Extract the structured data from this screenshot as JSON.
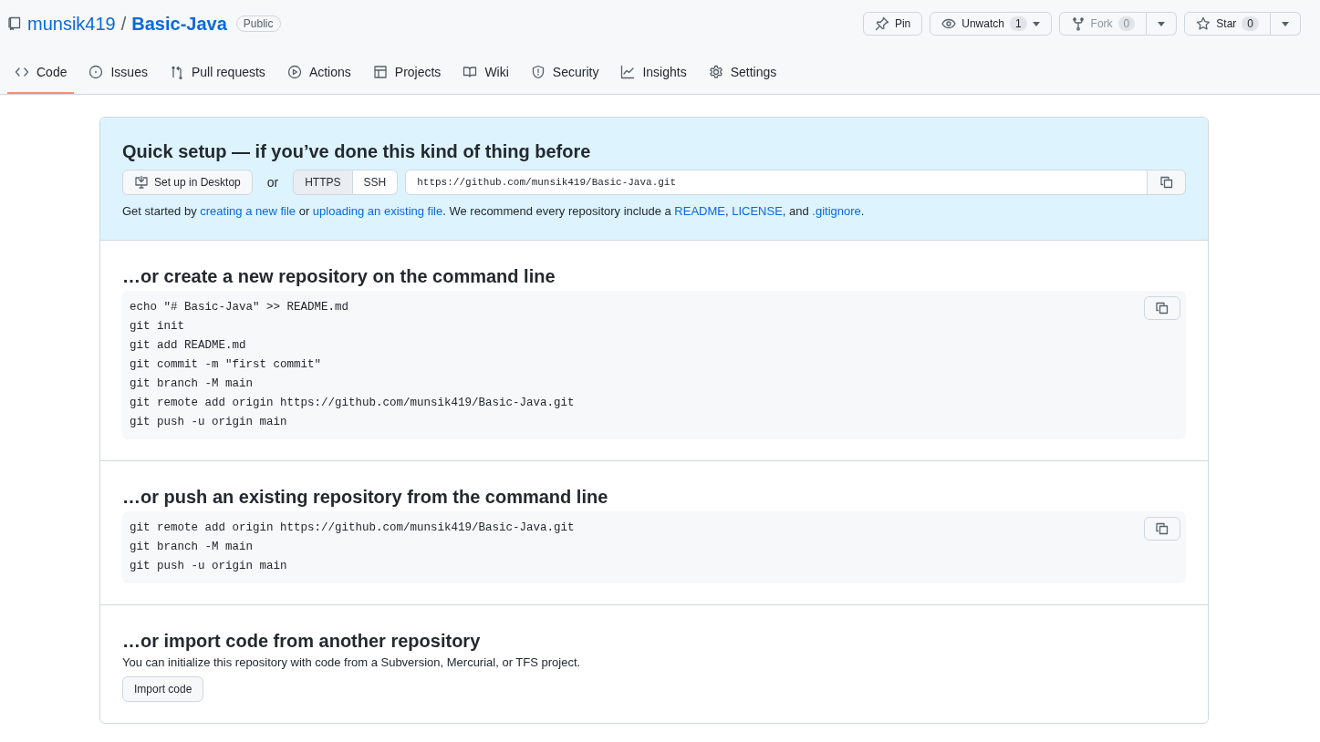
{
  "repo": {
    "owner": "munsik419",
    "separator": "/",
    "name": "Basic-Java",
    "visibility": "Public"
  },
  "actions": [
    {
      "kind": "pin",
      "label": "Pin",
      "disabled": false
    },
    {
      "kind": "watch",
      "label": "Unwatch",
      "count": "1",
      "disabled": false
    },
    {
      "kind": "fork",
      "label": "Fork",
      "count": "0",
      "disabled": true
    },
    {
      "kind": "star",
      "label": "Star",
      "count": "0",
      "disabled": false
    }
  ],
  "tabs": [
    {
      "kind": "code",
      "label": "Code",
      "selected": true
    },
    {
      "kind": "issues",
      "label": "Issues",
      "selected": false
    },
    {
      "kind": "pr",
      "label": "Pull requests",
      "selected": false
    },
    {
      "kind": "actions",
      "label": "Actions",
      "selected": false
    },
    {
      "kind": "projects",
      "label": "Projects",
      "selected": false
    },
    {
      "kind": "wiki",
      "label": "Wiki",
      "selected": false
    },
    {
      "kind": "security",
      "label": "Security",
      "selected": false
    },
    {
      "kind": "insights",
      "label": "Insights",
      "selected": false
    },
    {
      "kind": "settings",
      "label": "Settings",
      "selected": false
    }
  ],
  "quick_setup": {
    "title": "Quick setup — if you’ve done this kind of thing before",
    "desktop_button": "Set up in Desktop",
    "or": "or",
    "protocols": [
      {
        "label": "HTTPS",
        "selected": true
      },
      {
        "label": "SSH",
        "selected": false
      }
    ],
    "url": "https://github.com/munsik419/Basic-Java.git",
    "help": [
      {
        "kind": "text",
        "text": "Get started by "
      },
      {
        "kind": "link",
        "text": "creating a new file"
      },
      {
        "kind": "text",
        "text": " or "
      },
      {
        "kind": "link",
        "text": "uploading an existing file"
      },
      {
        "kind": "text",
        "text": ". We recommend every repository include a "
      },
      {
        "kind": "link",
        "text": "README"
      },
      {
        "kind": "text",
        "text": ", "
      },
      {
        "kind": "link",
        "text": "LICENSE"
      },
      {
        "kind": "text",
        "text": ", and "
      },
      {
        "kind": "link",
        "text": ".gitignore"
      },
      {
        "kind": "text",
        "text": "."
      }
    ]
  },
  "sections": [
    {
      "kind": "code",
      "title": "…or create a new repository on the command line",
      "lines": [
        "echo \"# Basic-Java\" >> README.md",
        "git init",
        "git add README.md",
        "git commit -m \"first commit\"",
        "git branch -M main",
        "git remote add origin https://github.com/munsik419/Basic-Java.git",
        "git push -u origin main"
      ]
    },
    {
      "kind": "code",
      "title": "…or push an existing repository from the command line",
      "lines": [
        "git remote add origin https://github.com/munsik419/Basic-Java.git",
        "git branch -M main",
        "git push -u origin main"
      ]
    },
    {
      "kind": "import",
      "title": "…or import code from another repository",
      "text": "You can initialize this repository with code from a Subversion, Mercurial, or TFS project.",
      "button": "Import code"
    }
  ]
}
